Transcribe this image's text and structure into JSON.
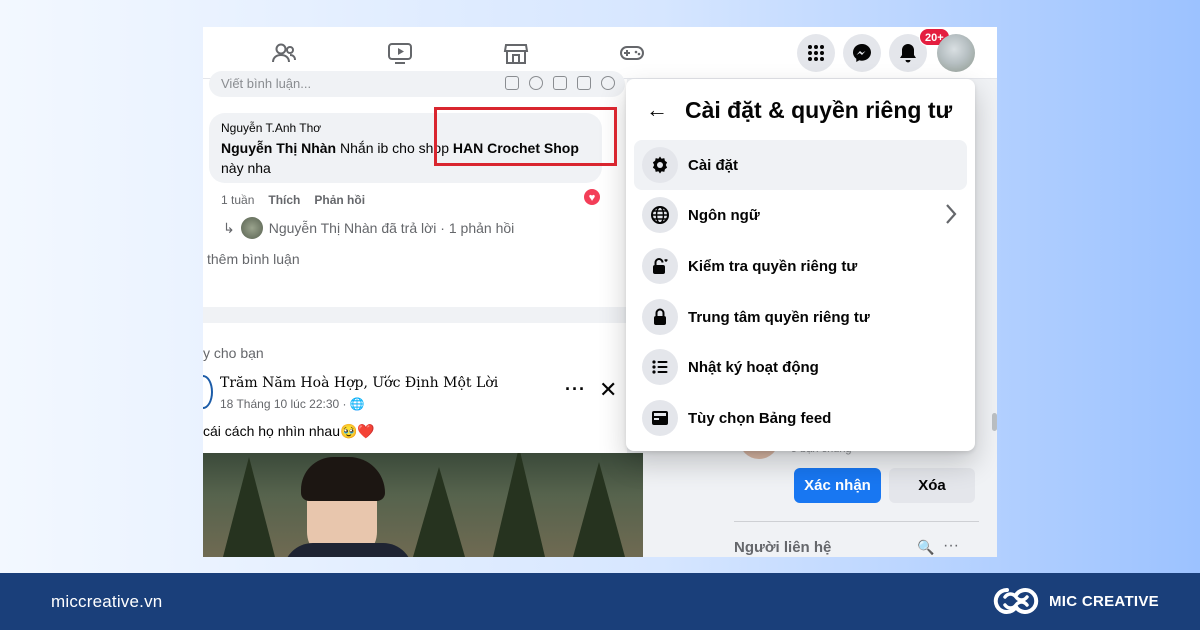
{
  "comment_box": {
    "placeholder": "Viết bình luận..."
  },
  "comment": {
    "author": "Nguyễn T.Anh Thơ",
    "mention": "Nguyễn Thị Nhàn",
    "text_mid": " Nhắn ib cho shop ",
    "shop": "HAN Crochet Shop",
    "text_end": "này nha",
    "time": "1 tuần",
    "like": "Thích",
    "reply": "Phản hồi",
    "reply_summary": "Nguyễn Thị Nhàn đã trả lời · 1 phản hồi"
  },
  "more_comments": "thêm bình luận",
  "suggested_label": "y cho bạn",
  "post": {
    "title": "Trăm Năm Hoà Hợp, Ước Định Một Lời",
    "time": "18 Tháng 10 lúc 22:30 · ",
    "caption": "cái cách họ nhìn nhau🥹❤️"
  },
  "top_nav": {
    "badge": "20+"
  },
  "menu": {
    "title": "Cài đặt & quyền riêng tư",
    "items": [
      {
        "label": "Cài đặt",
        "icon": "gear-icon"
      },
      {
        "label": "Ngôn ngữ",
        "icon": "globe-icon"
      },
      {
        "label": "Kiểm tra quyền riêng tư",
        "icon": "lock-heart-icon"
      },
      {
        "label": "Trung tâm quyền riêng tư",
        "icon": "lock-icon"
      },
      {
        "label": "Nhật ký hoạt động",
        "icon": "list-icon"
      },
      {
        "label": "Tùy chọn Bảng feed",
        "icon": "feed-icon"
      }
    ]
  },
  "friend_request": {
    "mutual": "9 bạn chung",
    "confirm": "Xác nhận",
    "delete": "Xóa"
  },
  "contacts": {
    "label": "Người liên hệ"
  },
  "footer": {
    "url": "miccreative.vn",
    "brand": "MIC CREATIVE"
  },
  "colors": {
    "accent": "#1877f2",
    "highlight": "#d9262f",
    "footer_bg": "#1a3f7a"
  }
}
